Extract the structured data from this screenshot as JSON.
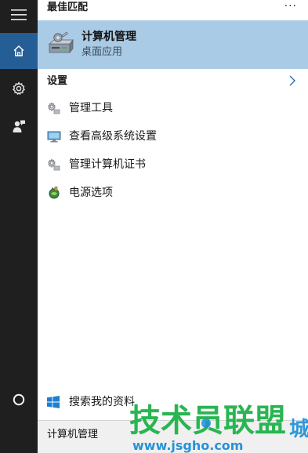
{
  "rail": {
    "items": [
      {
        "name": "menu",
        "icon": "hamburger-icon"
      },
      {
        "name": "home",
        "icon": "home-icon",
        "selected": true
      },
      {
        "name": "settings",
        "icon": "gear-icon"
      },
      {
        "name": "feedback",
        "icon": "person-feedback-icon"
      },
      {
        "name": "cortana",
        "icon": "cortana-circle-icon"
      }
    ]
  },
  "best_match": {
    "section_title": "最佳匹配",
    "more": "···",
    "title": "计算机管理",
    "subtitle": "桌面应用",
    "icon": "computer-management-icon"
  },
  "settings": {
    "label": "设置",
    "items": [
      {
        "label": "管理工具",
        "icon": "admin-tools-icon"
      },
      {
        "label": "查看高级系统设置",
        "icon": "monitor-icon"
      },
      {
        "label": "管理计算机证书",
        "icon": "certificate-icon"
      },
      {
        "label": "电源选项",
        "icon": "power-options-icon"
      }
    ]
  },
  "search_mine": {
    "label": "搜索我的资料",
    "icon": "windows-logo-icon"
  },
  "search_box": {
    "value": "计算机管理"
  },
  "watermark": {
    "text": "技术员联盟",
    "url": "www.jsgho.com",
    "extra": "城"
  },
  "colors": {
    "rail_bg": "#1f1f1f",
    "rail_selected": "#255e95",
    "highlight": "#a9cbe6",
    "watermark_green": "#1fb24a"
  }
}
